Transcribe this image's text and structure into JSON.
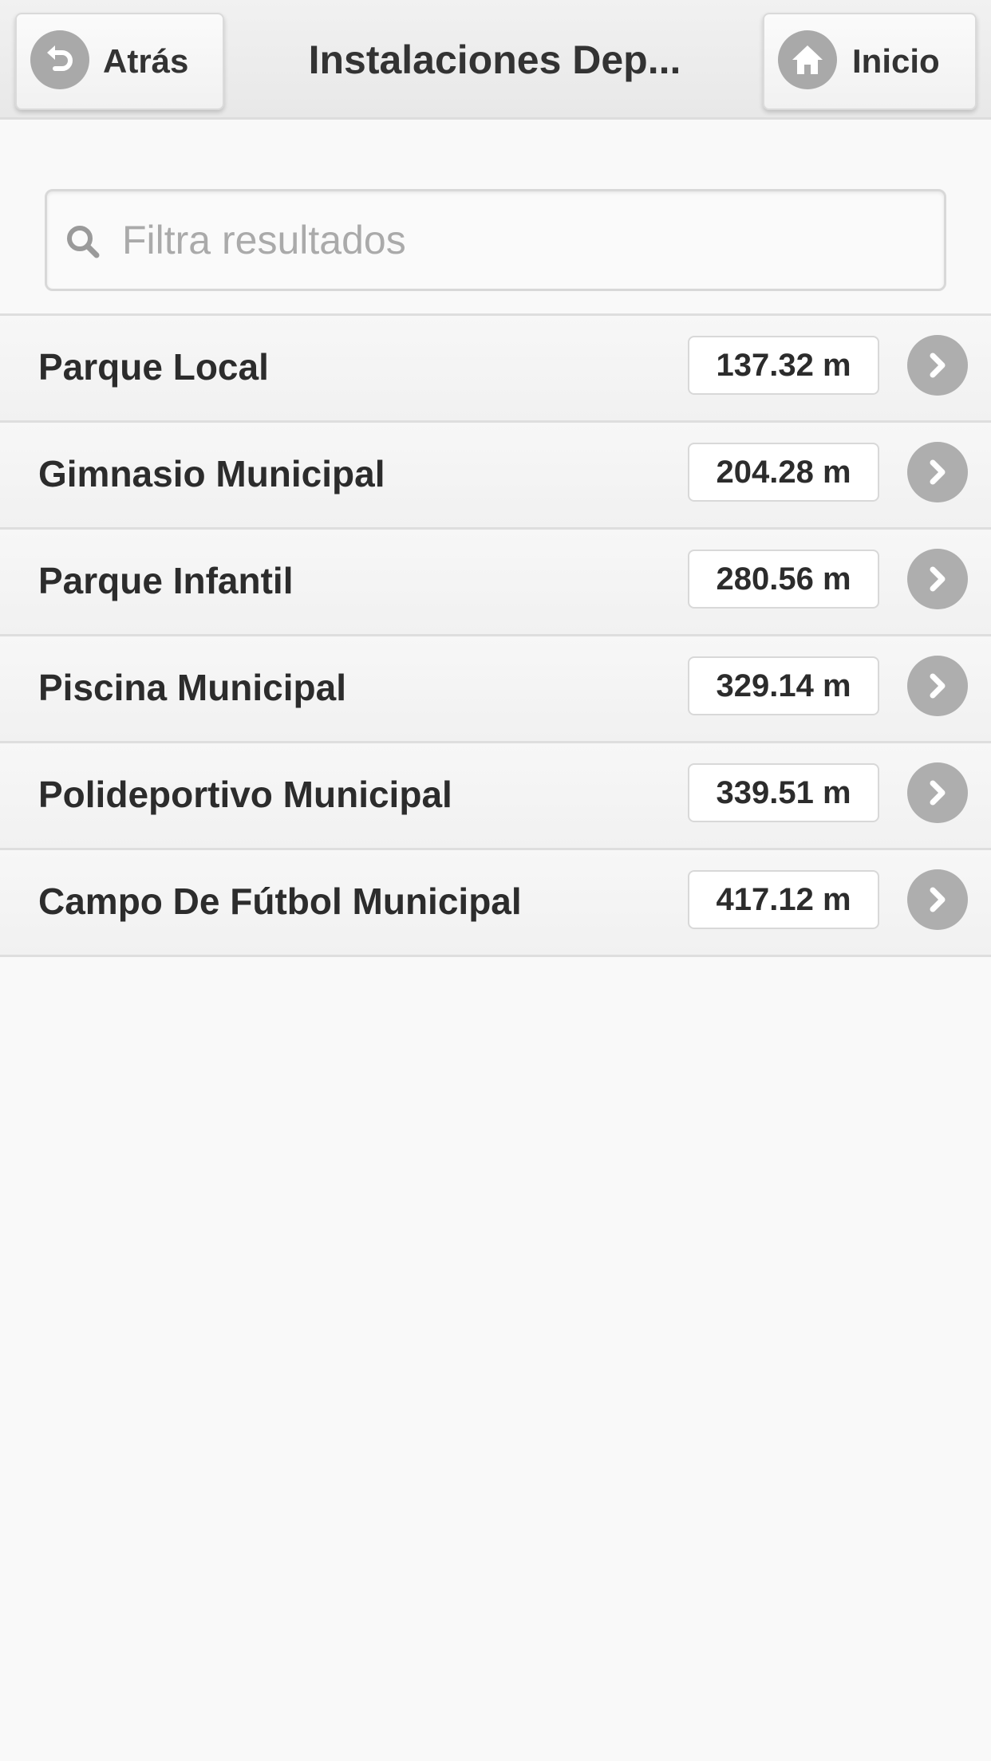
{
  "header": {
    "back_label": "Atrás",
    "title": "Instalaciones Dep...",
    "home_label": "Inicio"
  },
  "search": {
    "placeholder": "Filtra resultados",
    "value": ""
  },
  "items": [
    {
      "name": "Parque Local",
      "distance": "137.32 m"
    },
    {
      "name": "Gimnasio Municipal",
      "distance": "204.28 m"
    },
    {
      "name": "Parque Infantil",
      "distance": "280.56 m"
    },
    {
      "name": "Piscina Municipal",
      "distance": "329.14 m"
    },
    {
      "name": "Polideportivo Municipal",
      "distance": "339.51 m"
    },
    {
      "name": "Campo De Fútbol Municipal",
      "distance": "417.12 m"
    }
  ],
  "icons": {
    "back": "back-arrow-icon",
    "home": "home-icon",
    "search": "search-icon",
    "row_arrow": "chevron-right-icon"
  },
  "colors": {
    "icon_gray": "#aaaaaa",
    "text": "#333333",
    "placeholder": "#aaaaaa",
    "background": "#f9f9f9"
  }
}
